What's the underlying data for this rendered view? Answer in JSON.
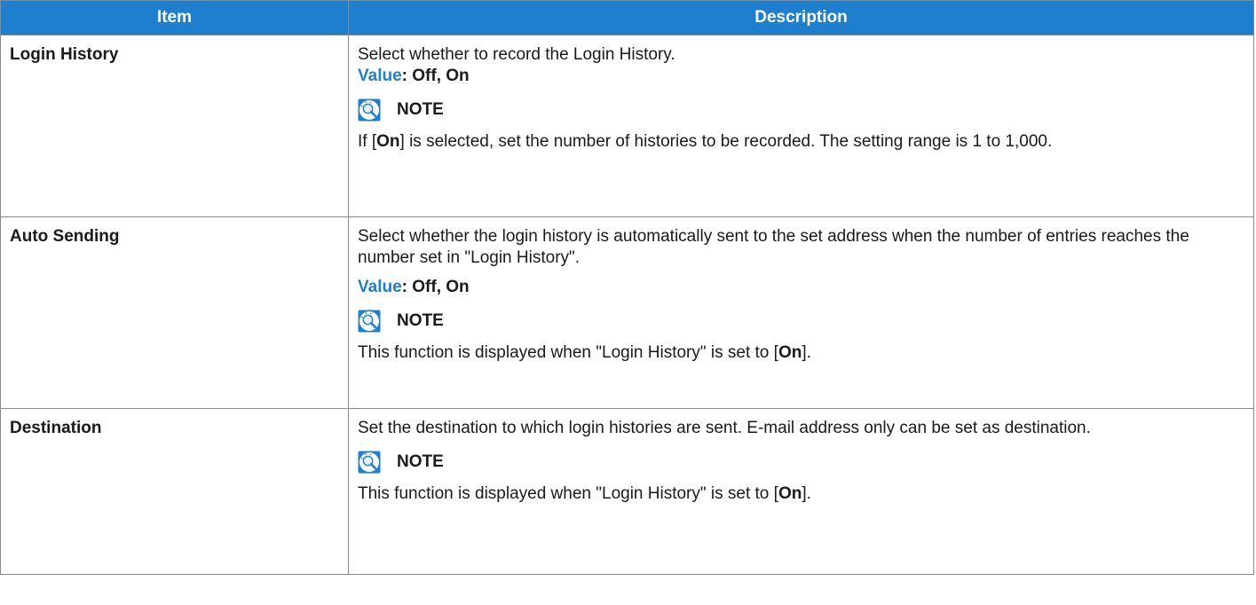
{
  "header": {
    "item": "Item",
    "description": "Description"
  },
  "rows": [
    {
      "item": "Login History",
      "desc": "Select whether to record the Login History.",
      "value_label": "Value",
      "value_text": ": Off, On",
      "note_title": "NOTE",
      "note_before": "If [",
      "note_bold": "On",
      "note_after": "] is selected, set the number of histories to be recorded. The setting range is 1 to 1,000."
    },
    {
      "item": "Auto Sending",
      "desc": "Select whether the login history is automatically sent to the set address when the number of entries reaches the number set in \"Login History\".",
      "value_label": "Value",
      "value_text": ": Off, On",
      "note_title": "NOTE",
      "note_before": "This function is displayed when \"Login History\" is set to [",
      "note_bold": "On",
      "note_after": "]."
    },
    {
      "item": "Destination",
      "desc": "Set the destination to which login histories are sent. E-mail address only can be set as destination.",
      "note_title": "NOTE",
      "note_before": "This function is displayed when \"Login History\" is set to [",
      "note_bold": "On",
      "note_after": "]."
    }
  ],
  "icons": {
    "note": "note-lightbulb-icon"
  },
  "colors": {
    "header_bg": "#1f7fcf",
    "value_label": "#1f7fcf",
    "border": "#8a8a8a"
  }
}
